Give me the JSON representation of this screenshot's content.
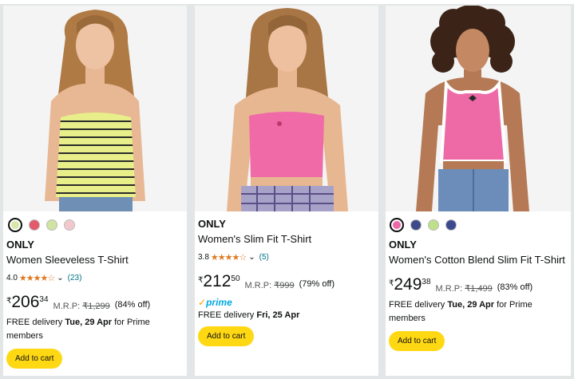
{
  "top_strip": {
    "text": "…"
  },
  "products": [
    {
      "image": {
        "subject": "woman-in-striped-tank-top",
        "top_color": "#e8ef8a",
        "bg": "#f4f4f4"
      },
      "swatches": [
        "#d7e8a8",
        "#e35a6a",
        "#cfe3a3",
        "#f3c8cc"
      ],
      "brand": "ONLY",
      "title": "Women Sleeveless T-Shirt",
      "rating": "4.0",
      "stars": "★★★★☆",
      "reviews": "(23)",
      "currency": "₹",
      "price_whole": "206",
      "price_fraction": "34",
      "mrp_label": "M.R.P:",
      "mrp_value": "₹1,299",
      "discount": "(84% off)",
      "delivery_prefix": "FREE delivery ",
      "delivery_date": "Tue, 29 Apr",
      "delivery_suffix": " for Prime members",
      "button": "Add to cart"
    },
    {
      "image": {
        "subject": "woman-in-pink-crop-top",
        "top_color": "#f06aa8",
        "bg": "#f4f4f4"
      },
      "brand": "ONLY",
      "title": "Women's Slim Fit T-Shirt",
      "rating": "3.8",
      "stars": "★★★★☆",
      "reviews": "(5)",
      "currency": "₹",
      "price_whole": "212",
      "price_fraction": "50",
      "mrp_label": "M.R.P:",
      "mrp_value": "₹999",
      "discount": "(79% off)",
      "prime_check": "✓",
      "prime_label": "prime",
      "delivery_prefix": "FREE delivery ",
      "delivery_date": "Fri, 25 Apr",
      "button": "Add to cart"
    },
    {
      "image": {
        "subject": "woman-in-pink-tank-top",
        "top_color": "#ee6aa6",
        "bg": "#f4f4f4"
      },
      "swatches": [
        "#e96aa6",
        "#3e4a8a",
        "#bfe08a",
        "#3b4a8d"
      ],
      "brand": "ONLY",
      "title": "Women's Cotton Blend Slim Fit T-Shirt",
      "currency": "₹",
      "price_whole": "249",
      "price_fraction": "38",
      "mrp_label": "M.R.P:",
      "mrp_value": "₹1,499",
      "discount": "(83% off)",
      "delivery_prefix": "FREE delivery ",
      "delivery_date": "Tue, 29 Apr",
      "delivery_suffix": " for Prime members",
      "button": "Add to cart"
    }
  ],
  "colors": {
    "button": "#ffd814",
    "star": "#de7921",
    "link": "#007185",
    "prime": "#00a8e1"
  }
}
